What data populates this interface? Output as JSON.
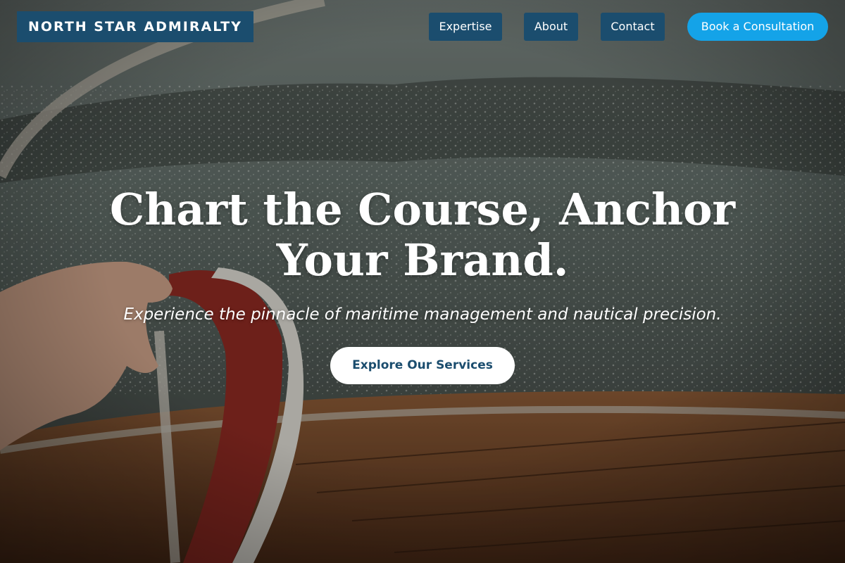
{
  "brand": {
    "name": "NORTH STAR ADMIRALTY"
  },
  "nav": {
    "links": [
      {
        "label": "Expertise"
      },
      {
        "label": "About"
      },
      {
        "label": "Contact"
      }
    ],
    "cta_label": "Book a Consultation"
  },
  "hero": {
    "headline": "Chart the Course, Anchor Your Brand.",
    "subheadline": "Experience the pinnacle of maritime management and nautical precision.",
    "cta_label": "Explore Our Services"
  },
  "colors": {
    "nav_background": "#1b4d6e",
    "accent": "#14a3e8",
    "cta_text": "#1b4d6e"
  }
}
